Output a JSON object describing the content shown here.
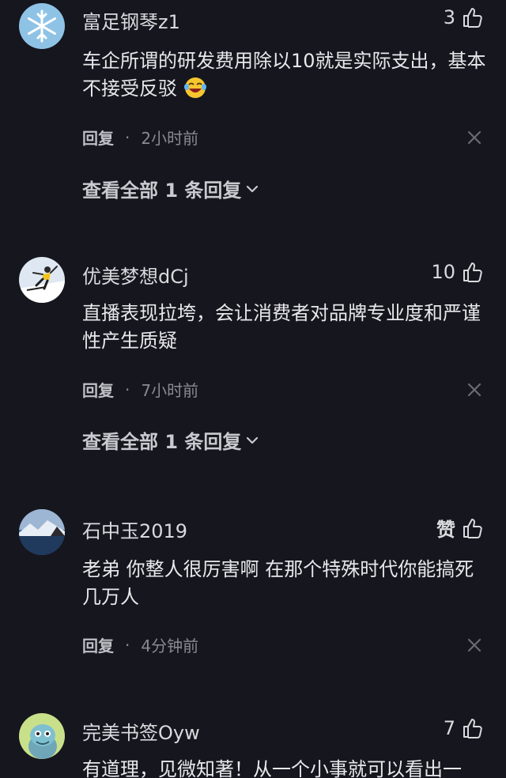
{
  "comments": [
    {
      "username": "富足钢琴z1",
      "likes": "3",
      "text": "车企所谓的研发费用除以10就是实际支出，基本不接受反驳",
      "reply_label": "回复",
      "separator": "·",
      "time": "2小时前",
      "view_replies": "查看全部 1 条回复",
      "avatar_icon": "snowflake-avatar",
      "emoji": "laughing-crying-emoji"
    },
    {
      "username": "优美梦想dCj",
      "likes": "10",
      "text": "直播表现拉垮，会让消费者对品牌专业度和严谨性产生质疑",
      "reply_label": "回复",
      "separator": "·",
      "time": "7小时前",
      "view_replies": "查看全部 1 条回复",
      "avatar_icon": "skier-avatar"
    },
    {
      "username": "石中玉2019",
      "likes": "赞",
      "text": "老弟 你整人很厉害啊 在那个特殊时代你能搞死几万人",
      "reply_label": "回复",
      "separator": "·",
      "time": "4分钟前",
      "avatar_icon": "lake-avatar"
    },
    {
      "username": "完美书签Oyw",
      "likes": "7",
      "text": "有道理，见微知著！从一个小事就可以看出一",
      "avatar_icon": "cartoon-avatar"
    }
  ],
  "colors": {
    "background": "#16161e",
    "text_primary": "#e8e8ec",
    "text_secondary": "#8a8a92"
  }
}
